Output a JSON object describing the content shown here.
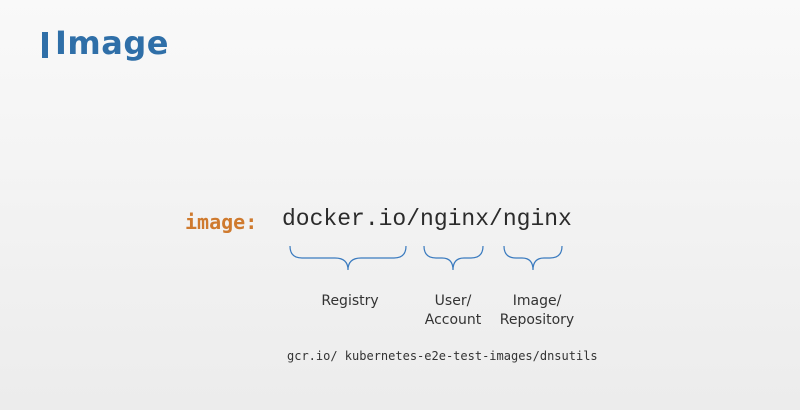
{
  "slide": {
    "title": "Image"
  },
  "diagram": {
    "key_label": "image:",
    "image_path": "docker.io/nginx/nginx",
    "segments": [
      {
        "part": "docker.io",
        "label_line1": "Registry",
        "label_line2": ""
      },
      {
        "part": "nginx",
        "label_line1": "User/",
        "label_line2": "Account"
      },
      {
        "part": "nginx",
        "label_line1": "Image/",
        "label_line2": "Repository"
      }
    ],
    "example_path": "gcr.io/ kubernetes-e2e-test-images/dnsutils"
  },
  "colors": {
    "title": "#2f6fa8",
    "key": "#cf7a2e",
    "brace": "#3b7bbf",
    "text": "#333333"
  }
}
